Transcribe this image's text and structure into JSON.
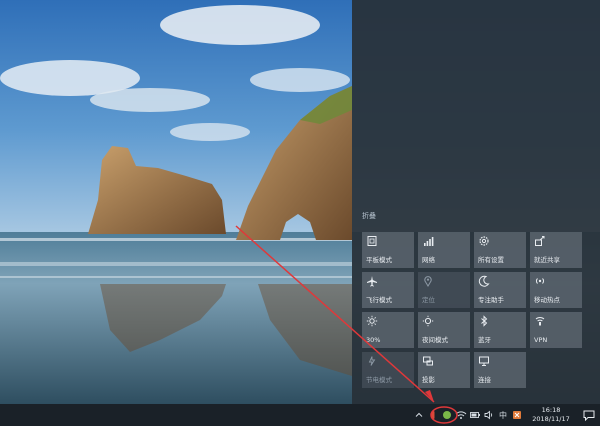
{
  "action_center": {
    "collapse_label": "折叠",
    "tiles": [
      {
        "label": "平板模式",
        "icon": "tablet-mode-icon",
        "state": "normal"
      },
      {
        "label": "网络",
        "icon": "network-icon",
        "state": "normal"
      },
      {
        "label": "所有设置",
        "icon": "settings-gear-icon",
        "state": "normal"
      },
      {
        "label": "就近共享",
        "icon": "nearby-share-icon",
        "state": "normal"
      },
      {
        "label": "飞行模式",
        "icon": "airplane-icon",
        "state": "normal"
      },
      {
        "label": "定位",
        "icon": "location-icon",
        "state": "dim"
      },
      {
        "label": "专注助手",
        "icon": "moon-icon",
        "state": "normal"
      },
      {
        "label": "移动热点",
        "icon": "hotspot-icon",
        "state": "normal"
      },
      {
        "label": "30%",
        "icon": "brightness-icon",
        "state": "normal"
      },
      {
        "label": "夜间模式",
        "icon": "night-light-icon",
        "state": "normal"
      },
      {
        "label": "蓝牙",
        "icon": "bluetooth-icon",
        "state": "normal"
      },
      {
        "label": "VPN",
        "icon": "vpn-icon",
        "state": "normal"
      },
      {
        "label": "节电模式",
        "icon": "battery-saver-icon",
        "state": "dim"
      },
      {
        "label": "投影",
        "icon": "project-icon",
        "state": "normal"
      },
      {
        "label": "连接",
        "icon": "connect-icon",
        "state": "normal"
      }
    ]
  },
  "taskbar": {
    "ime_label": "中",
    "time": "16:18",
    "date": "2018/11/17"
  },
  "colors": {
    "annotation": "#e0383a",
    "tile": "#626c76",
    "panel": "#283038"
  }
}
